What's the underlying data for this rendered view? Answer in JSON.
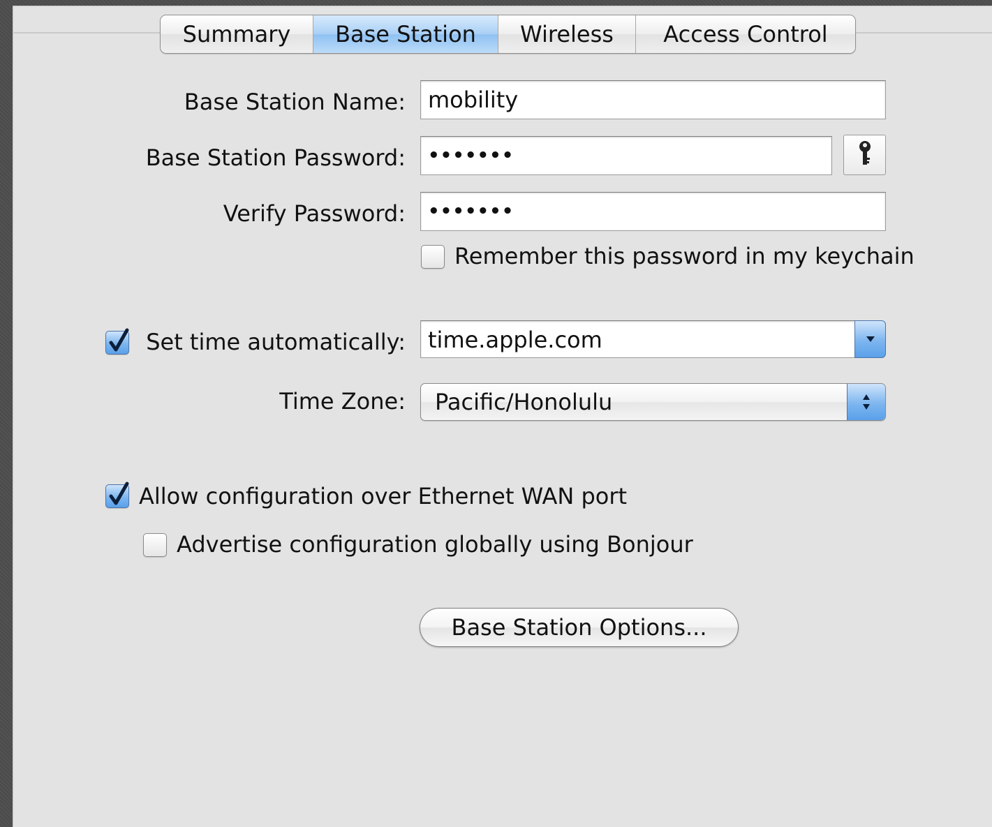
{
  "tabs": [
    {
      "label": "Summary",
      "active": false
    },
    {
      "label": "Base Station",
      "active": true
    },
    {
      "label": "Wireless",
      "active": false
    },
    {
      "label": "Access Control",
      "active": false
    }
  ],
  "form": {
    "name_label": "Base Station Name:",
    "name_value": "mobility",
    "password_label": "Base Station Password:",
    "password_value": "•••••••",
    "verify_label": "Verify Password:",
    "verify_value": "•••••••",
    "remember_label": "Remember this password in my keychain",
    "remember_checked": false,
    "set_time_label": "Set time automatically:",
    "set_time_checked": true,
    "time_server_value": "time.apple.com",
    "time_zone_label": "Time Zone:",
    "time_zone_value": "Pacific/Honolulu",
    "allow_wan_label": "Allow configuration over Ethernet WAN port",
    "allow_wan_checked": true,
    "advertise_label": "Advertise configuration globally using Bonjour",
    "advertise_checked": false,
    "options_button": "Base Station Options..."
  },
  "icons": {
    "keychain_button": "key-icon",
    "combo_arrow": "chevron-down-icon",
    "popup_arrows": "up-down-arrows-icon",
    "checkmark": "checkmark-icon"
  },
  "colors": {
    "panel": "#e3e3e3",
    "accent": "#7db6ef",
    "backdrop": "#4d4d4d"
  }
}
